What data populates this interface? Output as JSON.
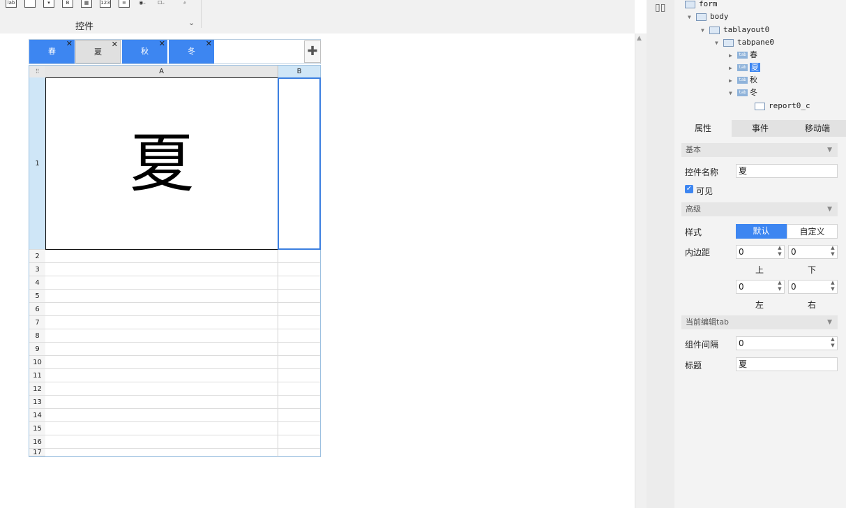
{
  "toolbar": {
    "icons": [
      "lab-icon",
      "frame-icon",
      "dropdown-icon",
      "button-icon",
      "grid-icon",
      "number-icon",
      "textarea-icon",
      "radio-icon",
      "checkbox-icon",
      "preview-icon"
    ],
    "group_label": "控件"
  },
  "tabs": [
    {
      "label": "春",
      "active": false
    },
    {
      "label": "夏",
      "active": true
    },
    {
      "label": "秋",
      "active": false
    },
    {
      "label": "冬",
      "active": false
    }
  ],
  "grid": {
    "columns": [
      "A",
      "B"
    ],
    "rows": [
      "1",
      "2",
      "3",
      "4",
      "5",
      "6",
      "7",
      "8",
      "9",
      "10",
      "11",
      "12",
      "13",
      "14",
      "15",
      "16",
      "17"
    ],
    "cell_a1": "夏"
  },
  "tree": {
    "form": "form",
    "body": "body",
    "tablayout": "tablayout0",
    "tabpane": "tabpane0",
    "tab_icon": "tab",
    "items": [
      "春",
      "夏",
      "秋",
      "冬"
    ],
    "report": "report0_c"
  },
  "prop_tabs": [
    "属性",
    "事件",
    "移动端"
  ],
  "props": {
    "section_basic": "基本",
    "name_label": "控件名称",
    "name_value": "夏",
    "visible_label": "可见",
    "section_advanced": "高级",
    "style_label": "样式",
    "style_default": "默认",
    "style_custom": "自定义",
    "padding_label": "内边距",
    "pad_top": "0",
    "pad_bottom": "0",
    "pad_left": "0",
    "pad_right": "0",
    "top_label": "上",
    "bottom_label": "下",
    "left_label": "左",
    "right_label": "右",
    "section_current": "当前编辑tab",
    "gap_label": "组件间隔",
    "gap_value": "0",
    "title_label": "标题",
    "title_value": "夏"
  },
  "colors": {
    "accent": "#3d86f1",
    "panel": "#f3f3f3"
  }
}
